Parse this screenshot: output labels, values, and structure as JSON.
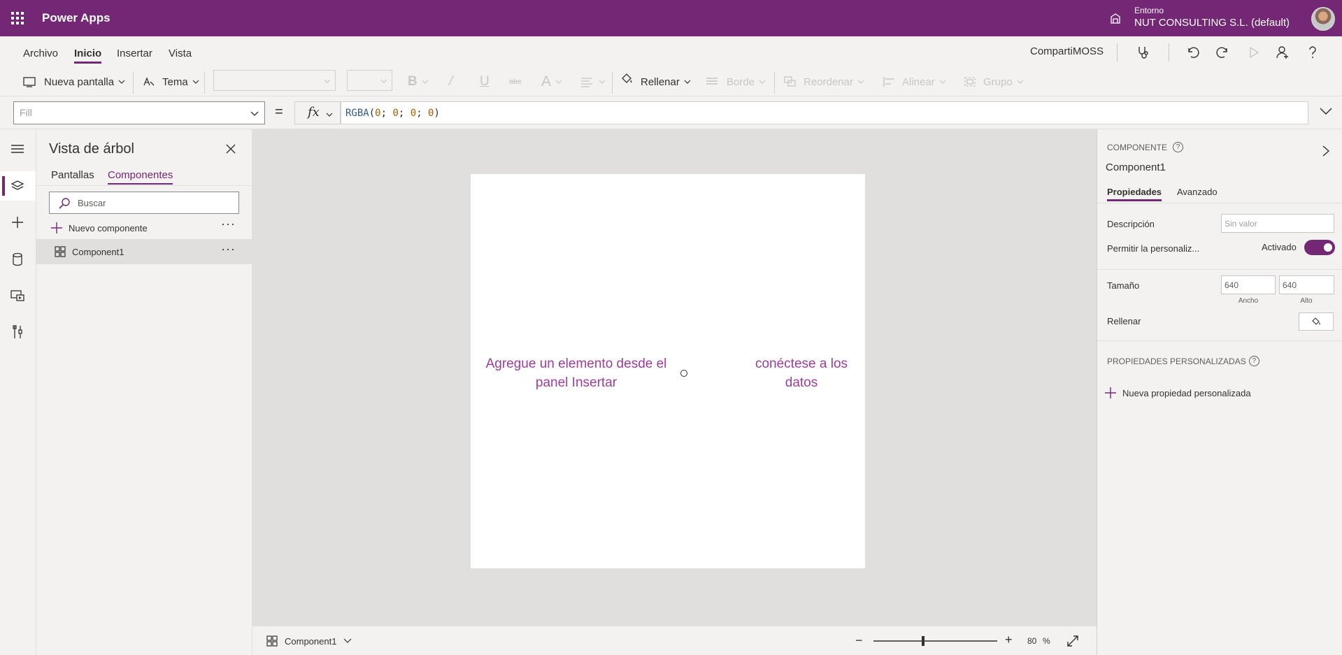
{
  "header": {
    "app_title": "Power Apps",
    "env_label": "Entorno",
    "env_value": "NUT CONSULTING S.L. (default)",
    "brand_color": "#742774"
  },
  "menu": {
    "tabs": [
      {
        "label": "Archivo",
        "active": false
      },
      {
        "label": "Inicio",
        "active": true
      },
      {
        "label": "Insertar",
        "active": false
      },
      {
        "label": "Vista",
        "active": false
      }
    ],
    "app_name": "CompartiMOSS"
  },
  "ribbon": {
    "new_screen": "Nueva pantalla",
    "theme": "Tema",
    "fill": "Rellenar",
    "border": "Borde",
    "reorder": "Reordenar",
    "align": "Alinear",
    "group": "Grupo"
  },
  "formula": {
    "property": "Fill",
    "fx": "fx",
    "equals": "=",
    "fn": "RGBA",
    "open": "(",
    "args": [
      "0",
      "0",
      "0",
      "0"
    ],
    "sep": "; ",
    "close": ")"
  },
  "tree": {
    "title": "Vista de árbol",
    "tabs": [
      {
        "label": "Pantallas",
        "active": false
      },
      {
        "label": "Componentes",
        "active": true
      }
    ],
    "search_placeholder": "Buscar",
    "new_component": "Nuevo componente",
    "items": [
      {
        "label": "Component1",
        "selected": true
      }
    ],
    "more": "···"
  },
  "canvas": {
    "hint_left": "Agregue un elemento desde el panel Insertar",
    "hint_right": "conéctese a los datos"
  },
  "statusbar": {
    "component": "Component1",
    "zoom_value": "80",
    "zoom_unit": "%",
    "zoom_fraction": 0.4
  },
  "properties": {
    "kind": "COMPONENTE",
    "name": "Component1",
    "tabs": [
      {
        "label": "Propiedades",
        "active": true
      },
      {
        "label": "Avanzado",
        "active": false
      }
    ],
    "description_label": "Descripción",
    "description_placeholder": "Sin valor",
    "customize_label": "Permitir la personaliz...",
    "customize_state": "Activado",
    "size_label": "Tamaño",
    "width": "640",
    "height": "640",
    "width_label": "Ancho",
    "height_label": "Alto",
    "fill_label": "Rellenar",
    "custom_heading": "PROPIEDADES PERSONALIZADAS",
    "new_custom": "Nueva propiedad personalizada"
  },
  "icons": [
    "waffle-icon",
    "notification-bell-icon",
    "stethoscope-icon",
    "undo-icon",
    "redo-icon",
    "play-icon",
    "person-icon",
    "help-icon",
    "hamburger-icon",
    "layers-icon",
    "plus-icon",
    "database-icon",
    "media-icon",
    "tools-icon",
    "close-icon",
    "search-icon",
    "component-icon",
    "expand-icon",
    "chevron-right-icon"
  ]
}
